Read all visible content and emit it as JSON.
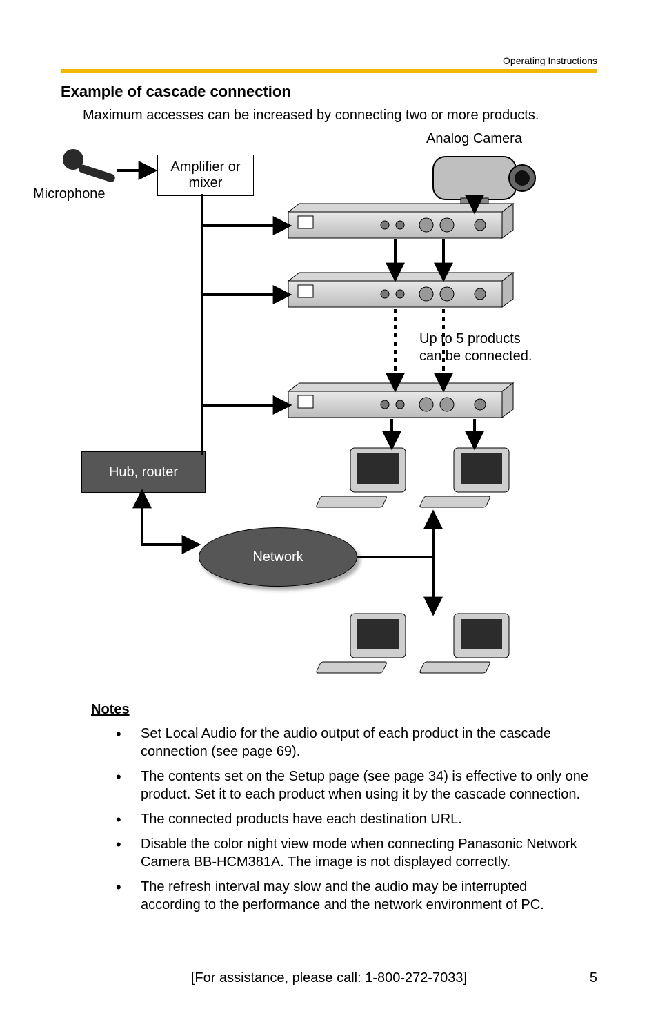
{
  "header": {
    "doc_label": "Operating Instructions"
  },
  "section": {
    "title": "Example of cascade connection",
    "intro": "Maximum accesses can be increased by connecting two or more products."
  },
  "diagram": {
    "labels": {
      "microphone": "Microphone",
      "amplifier": "Amplifier or mixer",
      "analog_camera": "Analog Camera",
      "cascade_note_l1": "Up to 5 products",
      "cascade_note_l2": "can be connected.",
      "hub_router": "Hub, router",
      "network": "Network"
    }
  },
  "notes": {
    "heading": "Notes",
    "items": [
      "Set Local Audio for the audio output of each product in the cascade connection (see page 69).",
      "The contents set on the Setup page (see page 34) is effective to only one product. Set it to each product when using it by the cascade connection.",
      "The connected products have each destination URL.",
      "Disable the color night view mode when connecting Panasonic Network Camera BB-HCM381A. The image is not displayed correctly.",
      "The refresh interval may slow and the audio may be interrupted according to the performance of and the network environment of PC."
    ],
    "items_display": [
      "Set Local Audio for the audio output of each product in the cascade connection (see page 69).",
      "The contents set on the Setup page (see page 34) is effective to only one product. Set it to each product when using it by the cascade connection.",
      "The connected products have each destination URL.",
      "Disable the color night view mode when connecting Panasonic Network Camera BB-HCM381A. The image is not displayed correctly.",
      "The refresh interval may slow and the audio may be interrupted according to the performance and the network environment of PC."
    ]
  },
  "footer": {
    "assist": "[For assistance, please call: 1-800-272-7033]",
    "page": "5"
  }
}
